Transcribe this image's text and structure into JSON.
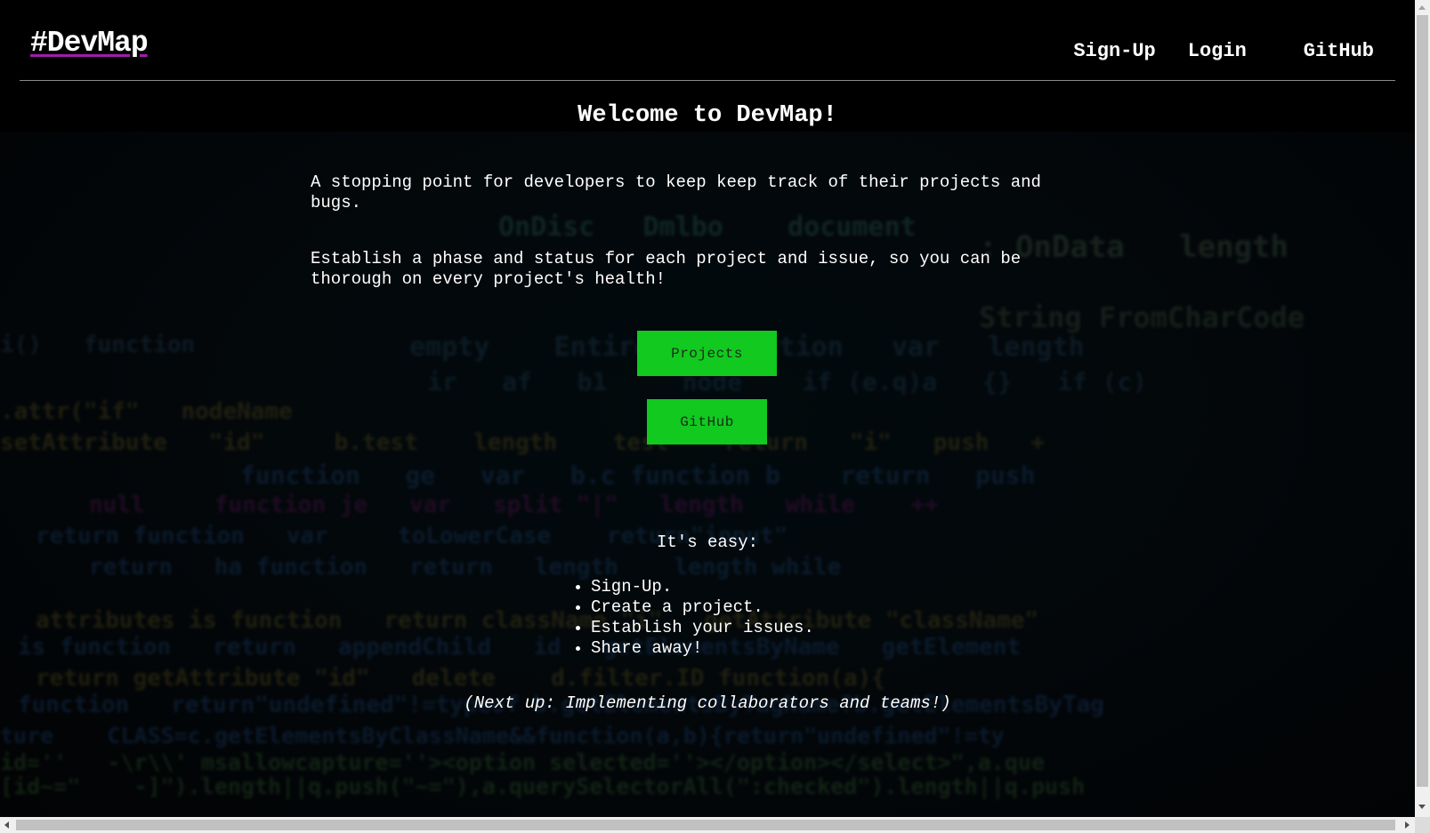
{
  "header": {
    "brand": "#DevMap",
    "nav": {
      "signup": "Sign-Up",
      "login": "Login",
      "github": "GitHub"
    }
  },
  "main": {
    "welcome": "Welcome to DevMap!",
    "intro": [
      "A stopping point for developers to keep keep track of their projects and bugs.",
      "Establish a phase and status for each project and issue, so you can be thorough on every project's health!"
    ],
    "buttons": {
      "projects": "Projects",
      "github": "GitHub"
    },
    "easy_heading": "It's easy:",
    "steps": [
      "Sign-Up.",
      "Create a project.",
      "Establish your issues.",
      "Share away!"
    ],
    "next_up": "(Next up: Implementing collaborators and teams!)"
  },
  "colors": {
    "background": "#000000",
    "accent_button": "#11c91f",
    "brand_underline": "#a11caa",
    "header_rule": "#8a8a8a"
  },
  "icons": {
    "scroll_up": "arrow-up-icon",
    "scroll_down": "arrow-down-icon",
    "scroll_left": "arrow-left-icon",
    "scroll_right": "arrow-right-icon"
  }
}
